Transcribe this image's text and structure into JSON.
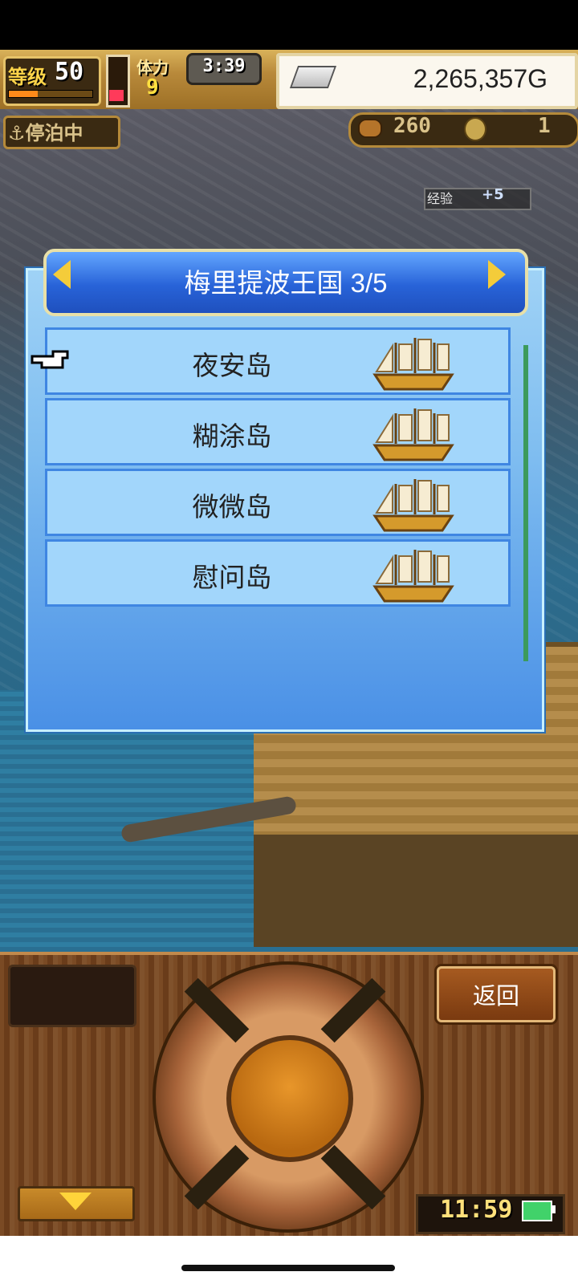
{
  "hud": {
    "level_label": "等级",
    "level_value": "50",
    "level_progress": 0.35,
    "stamina_label": "体力",
    "stamina_value": "9",
    "stamina_level": 0.25,
    "timer": "3:39",
    "gold": "2,265,357G"
  },
  "map": {
    "docked_status": "停泊中",
    "resource_value": "260",
    "coin_value": "1",
    "exp_label": "经验",
    "exp_value": "+5"
  },
  "dialog": {
    "title": "梅里提波王国 3/5",
    "islands": [
      {
        "name": "夜安岛",
        "icon": "sailing-ship-icon"
      },
      {
        "name": "糊涂岛",
        "icon": "sailing-ship-icon"
      },
      {
        "name": "微微岛",
        "icon": "sailing-ship-icon"
      },
      {
        "name": "慰问岛",
        "icon": "sailing-ship-icon"
      }
    ]
  },
  "controls": {
    "back_label": "返回",
    "clock": "11:59"
  },
  "colors": {
    "dialog_blue": "#4a90e6",
    "row_blue": "#a2d6fb",
    "arrow_gold": "#f4cc3a",
    "battery_green": "#41d26a"
  }
}
